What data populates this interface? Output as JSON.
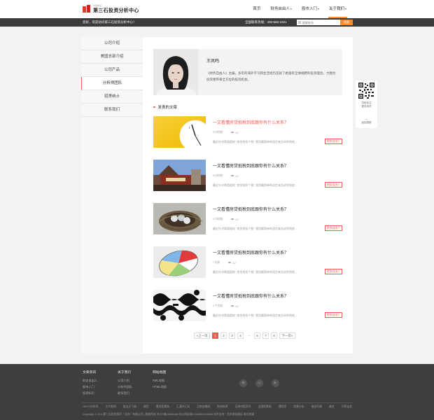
{
  "header": {
    "logo_sub": "价值投资",
    "logo_name": "第三石投资分析中心",
    "nav": [
      {
        "label": "首页",
        "caret": false,
        "active": false
      },
      {
        "label": "财务自由人",
        "caret": true,
        "active": false
      },
      {
        "label": "股市入门",
        "caret": true,
        "active": false
      },
      {
        "label": "关于我们",
        "caret": true,
        "active": true
      }
    ]
  },
  "topbar": {
    "welcome": "您好，欢迎访问第三石投资分析中心！",
    "hotline": "全国联系热线：400-666-1021",
    "search_placeholder": "搜索股东",
    "search_button": "搜索"
  },
  "sidebar": {
    "items": [
      "公司介绍",
      "美国总部介绍",
      "公司产品",
      "分析师团队",
      "招贤纳士",
      "联系我们"
    ],
    "active_index": 3
  },
  "profile": {
    "name": "王凤鸣",
    "bio": "《财务自由人》主编，多年的海外学习和生活经历造就了她富有全球视野的投资理念。力图为投资者带来全方位的投资机会。"
  },
  "articles_section": {
    "title": "发表的文章",
    "items": [
      {
        "title": "一文看懂房贷抵税到底跟你有什么关系？",
        "time": "2小时前",
        "views": "12",
        "excerpt": "最近针对两类租的 \"房贷抵扣个税\" 我用最简单的语言来告诉你到底...",
        "tag": "财务自由人",
        "highlight": true,
        "thumb": "clock"
      },
      {
        "title": "一文看懂房贷抵税到底跟你有什么关系？",
        "time": "2小时前",
        "views": "12",
        "excerpt": "最近针对两类租的 \"房贷抵扣个税\" 我用最简单的语言来告诉你到底...",
        "tag": "财务自由人",
        "highlight": false,
        "thumb": "store"
      },
      {
        "title": "一文看懂房贷抵税到底跟你有什么关系？",
        "time": "2小时前",
        "views": "12",
        "excerpt": "最近针对两类租的 \"房贷抵扣个税\" 我用最简单的语言来告诉你到底...",
        "tag": "财务自由人",
        "highlight": false,
        "thumb": "nest"
      },
      {
        "title": "一文看懂房贷抵税到底跟你有什么关系？",
        "time": "7天前",
        "views": "12",
        "excerpt": "最近针对两类租的 \"房贷抵扣个税\" 我用最简单的语言来告诉你到底...",
        "tag": "财务自由人",
        "highlight": false,
        "thumb": "pie"
      },
      {
        "title": "一文看懂房贷抵税到底跟你有什么关系？",
        "time": "1个月前",
        "views": "12",
        "excerpt": "最近针对两类租的 \"房贷抵扣个税\" 我用最简单的语言来告诉你到底...",
        "tag": "财务自由人",
        "highlight": false,
        "thumb": "pattern"
      }
    ]
  },
  "pagination": {
    "prev": "«上一页",
    "next": "下一页»",
    "pages": [
      "1",
      "2",
      "3",
      "4",
      "...",
      "6",
      "7",
      "8"
    ],
    "active": "1"
  },
  "qr": {
    "text_line1": "扫码关注",
    "text_line2": "更多资讯",
    "back_top": "返回顶部"
  },
  "footer": {
    "columns": [
      {
        "title": "文章资讯",
        "items": [
          "财务自由人",
          "股市入门",
          "投资知识"
        ]
      },
      {
        "title": "关于我们",
        "items": [
          "公司介绍",
          "分析师团队",
          "联系我们"
        ]
      },
      {
        "title": "网站地图",
        "items": [
          "XML地图",
          "HTML地图"
        ]
      }
    ],
    "links": [
      "HHYG分析师",
      "大牛股网",
      "股宝天下网",
      "期货",
      "黄金股票网",
      "汇通外汇网",
      "河南金融网",
      "财经新闻",
      "证券时报资讯",
      "全国股票网",
      "理财家",
      "股票分析",
      "基金行情",
      "基金",
      "利率走势"
    ],
    "copyright": "Copyright © 2014第三石投资顾问（北京）有限公司   |   版权所有 京ICP备12064485   京公网安备11010802009626   技术支持：北京网站建设 易优传媒"
  },
  "colors": {
    "accent": "#f05a50",
    "orange": "#ff8a2b",
    "dark": "#3b3b3b",
    "footer": "#3e3e3e"
  }
}
